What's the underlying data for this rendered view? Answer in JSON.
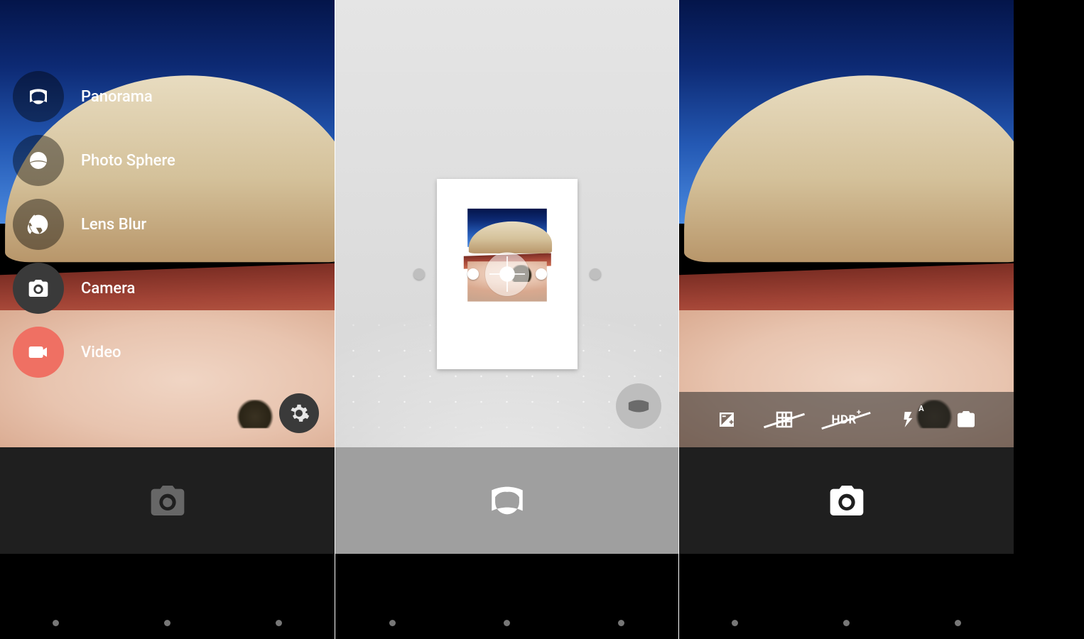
{
  "accent_color": "#ef7063",
  "modes": {
    "panorama": {
      "label": "Panorama",
      "icon": "panorama-icon"
    },
    "photosphere": {
      "label": "Photo Sphere",
      "icon": "photosphere-icon"
    },
    "lensblur": {
      "label": "Lens Blur",
      "icon": "aperture-icon"
    },
    "camera": {
      "label": "Camera",
      "icon": "camera-icon"
    },
    "video": {
      "label": "Video",
      "icon": "videocam-icon",
      "active": true
    }
  },
  "settings_button": {
    "icon": "gear-icon"
  },
  "panel_left": {
    "shutter_icon": "camera-icon",
    "shutter_enabled": false
  },
  "panel_mid": {
    "shutter_icon": "panorama-icon",
    "stitch_dots": 5,
    "pano_type_button_icon": "panorama-wide-icon"
  },
  "panel_right": {
    "shutter_icon": "camera-icon",
    "quick_settings": [
      {
        "name": "exposure",
        "icon": "exposure-icon"
      },
      {
        "name": "grid-off",
        "icon": "grid-off-icon"
      },
      {
        "name": "hdr-plus-off",
        "label": "HDR",
        "sup": "+",
        "struck": true
      },
      {
        "name": "flash-auto",
        "icon": "flash-auto-icon"
      },
      {
        "name": "switch-camera",
        "icon": "switch-camera-icon"
      }
    ]
  }
}
